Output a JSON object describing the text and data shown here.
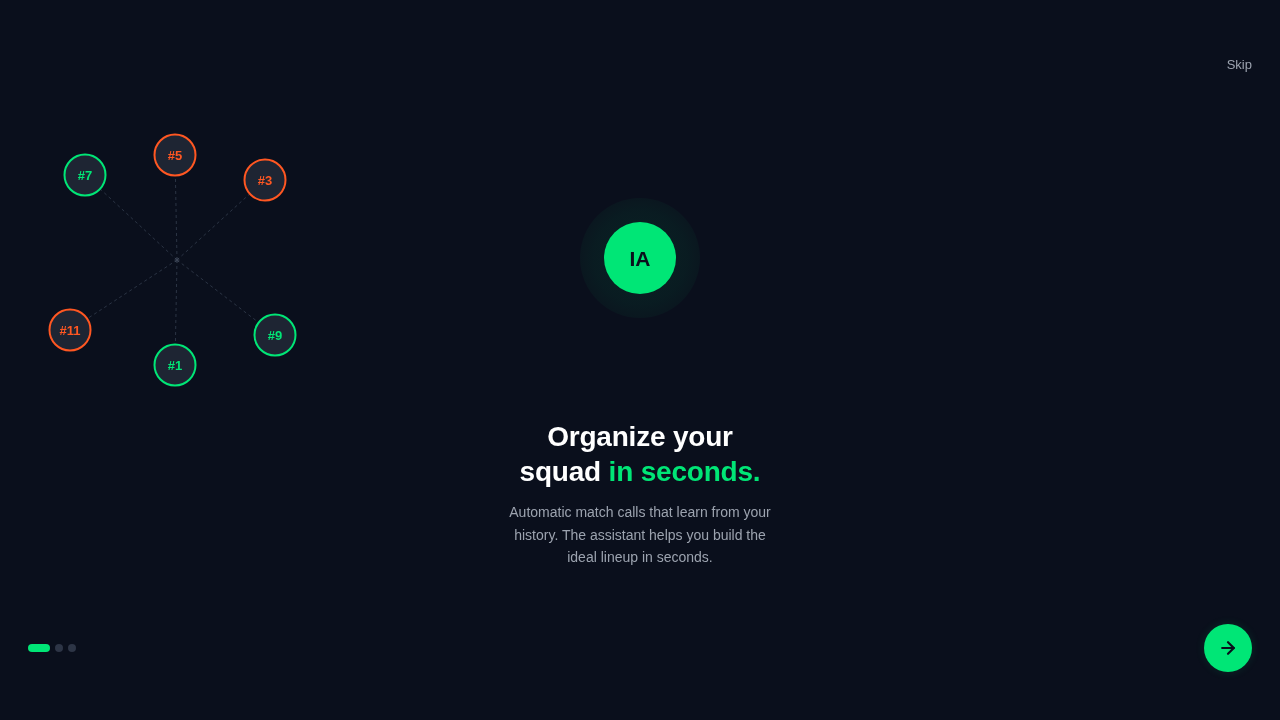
{
  "skip": "Skip",
  "diagram": {
    "players": [
      {
        "label": "#5",
        "color": "#ff5722"
      },
      {
        "label": "#7",
        "color": "#00e676"
      },
      {
        "label": "#3",
        "color": "#ff5722"
      },
      {
        "label": "#11",
        "color": "#ff5722"
      },
      {
        "label": "#9",
        "color": "#00e676"
      },
      {
        "label": "#1",
        "color": "#00e676"
      }
    ]
  },
  "badge": "IA",
  "heading": {
    "text": "Organize your squad",
    "highlight": "in seconds."
  },
  "description": "Automatic match calls that learn from your history. The assistant helps you build the ideal lineup in seconds.",
  "pagination": [
    {
      "selected": true
    },
    {
      "selected": false
    },
    {
      "selected": false
    }
  ]
}
